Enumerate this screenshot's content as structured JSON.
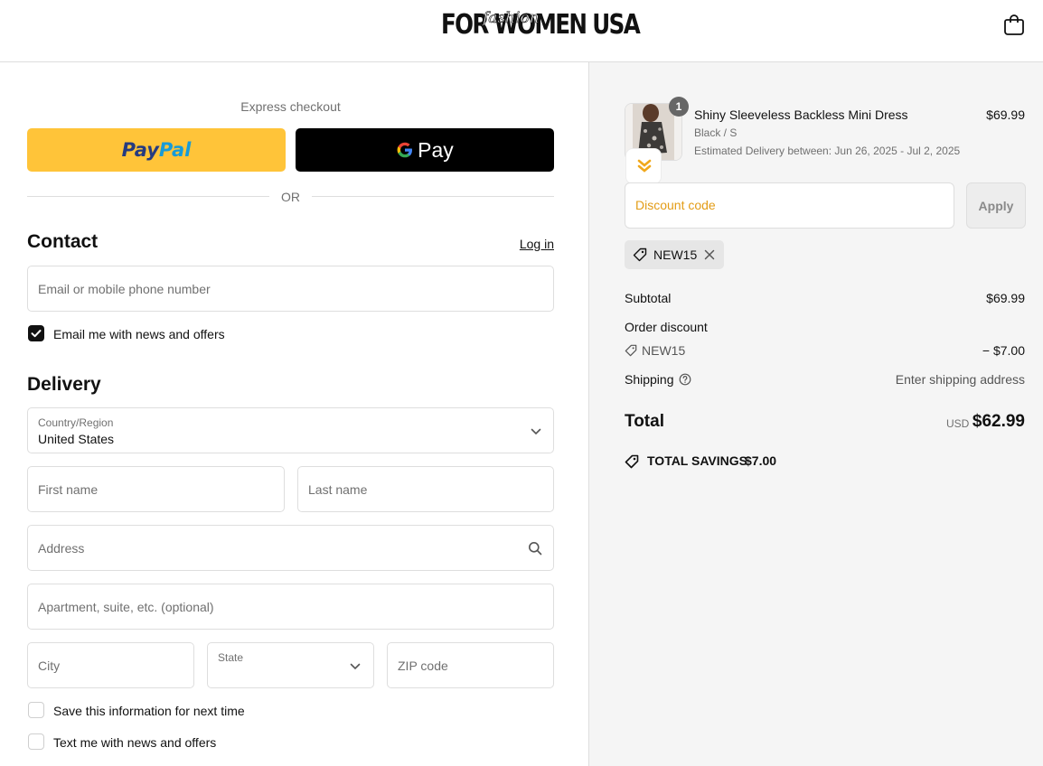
{
  "header": {
    "brand": "FOR WOMEN USA",
    "brand_script": "fashion"
  },
  "express": {
    "label": "Express checkout",
    "paypal_pay": "Pay",
    "paypal_pal": "Pal",
    "gpay_g": "G",
    "gpay_label": "Pay",
    "or": "OR"
  },
  "contact": {
    "title": "Contact",
    "login": "Log in",
    "email_placeholder": "Email or mobile phone number",
    "news_label": "Email me with news and offers",
    "news_checked": true
  },
  "delivery": {
    "title": "Delivery",
    "country_label": "Country/Region",
    "country_value": "United States",
    "first_name": "First name",
    "last_name": "Last name",
    "address": "Address",
    "apartment": "Apartment, suite, etc. (optional)",
    "city": "City",
    "state": "State",
    "zip": "ZIP code",
    "save_info": "Save this information for next time",
    "text_offers": "Text me with news and offers"
  },
  "cart": {
    "quantity": "1",
    "item_name": "Shiny Sleeveless Backless Mini Dress",
    "item_variant": "Black / S",
    "item_delivery": "Estimated Delivery between: Jun 26, 2025 - Jul 2, 2025",
    "item_price": "$69.99"
  },
  "discount": {
    "placeholder": "Discount code",
    "apply": "Apply",
    "applied_code": "NEW15"
  },
  "summary": {
    "subtotal_label": "Subtotal",
    "subtotal_value": "$69.99",
    "order_discount_label": "Order discount",
    "discount_code": "NEW15",
    "discount_value": "− $7.00",
    "shipping_label": "Shipping",
    "shipping_value": "Enter shipping address",
    "total_label": "Total",
    "currency": "USD",
    "total_value": "$62.99",
    "savings_label": "TOTAL SAVINGS",
    "savings_value": "$7.00"
  },
  "colors": {
    "paypal_yellow": "#ffc439",
    "discount_orange": "#e39c16",
    "right_bg": "#f5f5f5"
  },
  "icons": [
    "shopping-bag-icon",
    "google-g-icon",
    "checkmark-icon",
    "chevron-down-icon",
    "search-icon",
    "tag-icon",
    "close-icon",
    "help-circle-icon",
    "savings-tag-icon",
    "double-chevron-icon"
  ]
}
